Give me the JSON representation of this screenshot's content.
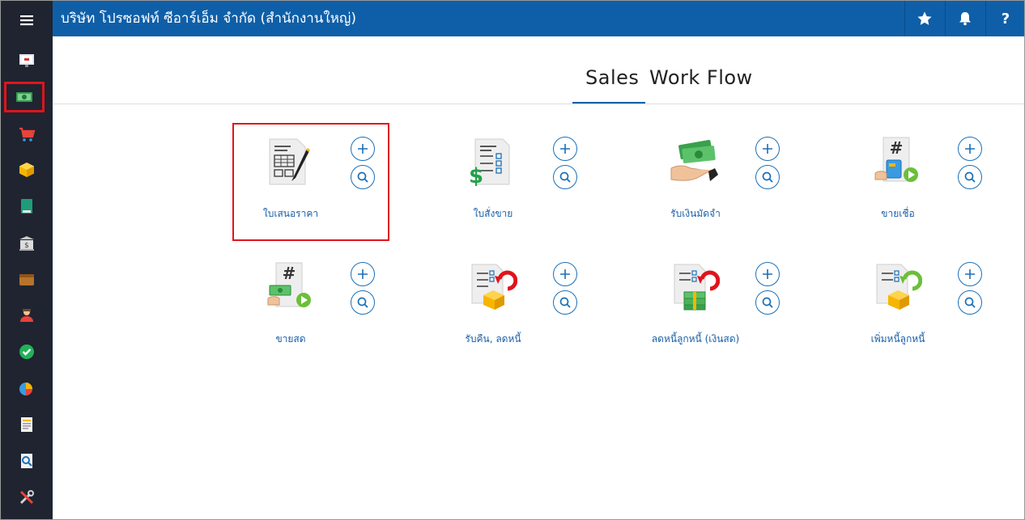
{
  "header": {
    "company_name": "บริษัท โปรซอฟท์ ซีอาร์เอ็ม จำกัด (สำนักงานใหญ่)"
  },
  "tabs": [
    {
      "label": "Sales"
    },
    {
      "label": "Work Flow"
    }
  ],
  "cards": [
    {
      "label": "ใบเสนอราคา"
    },
    {
      "label": "ใบสั่งขาย"
    },
    {
      "label": "รับเงินมัดจำ"
    },
    {
      "label": "ขายเชื่อ"
    },
    {
      "label": "ขายสด"
    },
    {
      "label": "รับคืน, ลดหนี้"
    },
    {
      "label": "ลดหนี้ลูกหนี้ (เงินสด)"
    },
    {
      "label": "เพิ่มหนี้ลูกหนี้"
    }
  ],
  "colors": {
    "topbar": "#0f5fa8",
    "sidebar": "#1f2430",
    "highlight": "#e0141c",
    "link": "#1a5fa8"
  }
}
